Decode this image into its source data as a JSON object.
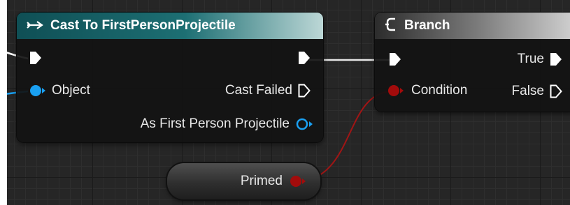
{
  "cast_node": {
    "title": "Cast To FirstPersonProjectile",
    "title_icon": "arrow-icon",
    "input_object_label": "Object",
    "output_cast_failed_label": "Cast Failed",
    "output_as_label": "As First Person Projectile",
    "colors": {
      "header": "#1d6f73",
      "object_pin": "#1aa0f2"
    }
  },
  "branch_node": {
    "title": "Branch",
    "title_icon": "branch-icon",
    "condition_label": "Condition",
    "true_label": "True",
    "false_label": "False",
    "colors": {
      "condition_pin": "#a20b0b"
    }
  },
  "primed_node": {
    "label": "Primed",
    "pin_color": "#a20b0b"
  }
}
